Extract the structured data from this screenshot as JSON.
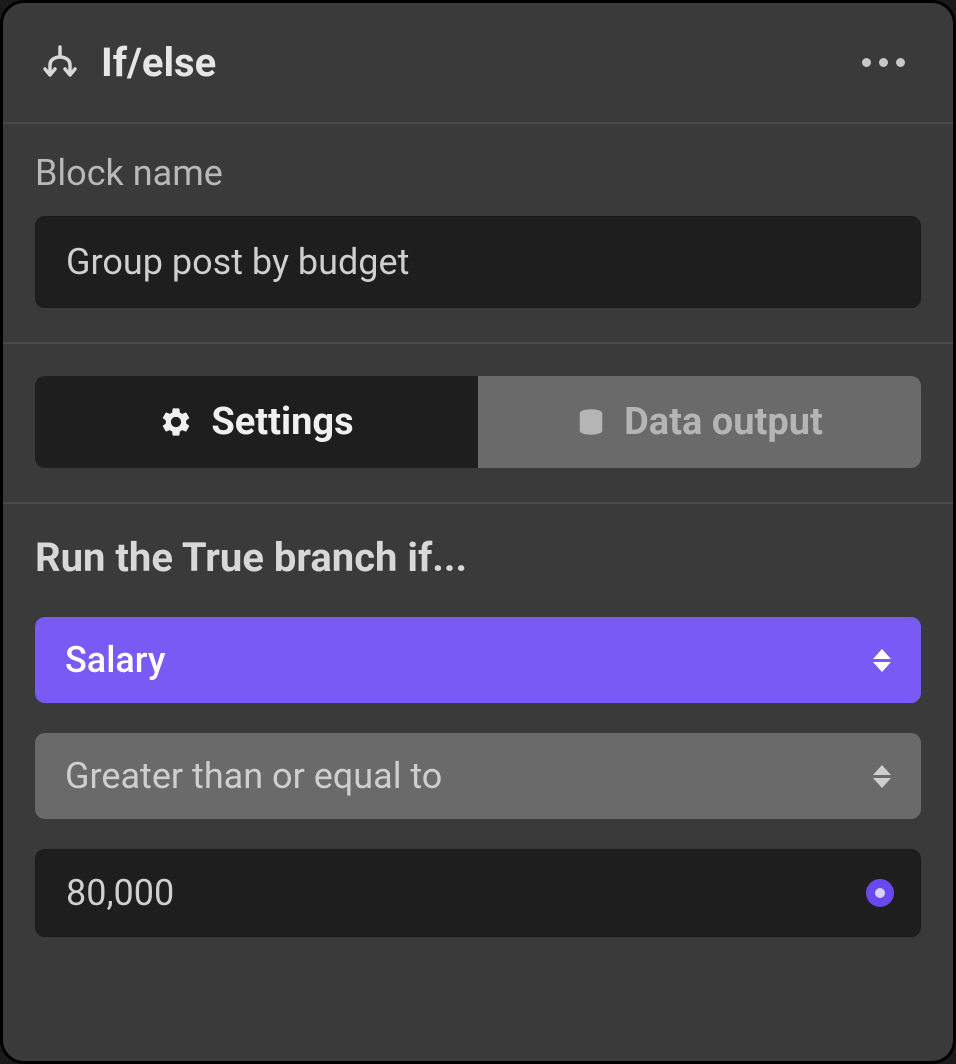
{
  "header": {
    "title": "If/else"
  },
  "blockName": {
    "label": "Block name",
    "value": "Group post by budget"
  },
  "tabs": {
    "settings": "Settings",
    "dataOutput": "Data output"
  },
  "condition": {
    "heading": "Run the True branch if...",
    "field": "Salary",
    "operator": "Greater than or equal to",
    "value": "80,000"
  }
}
